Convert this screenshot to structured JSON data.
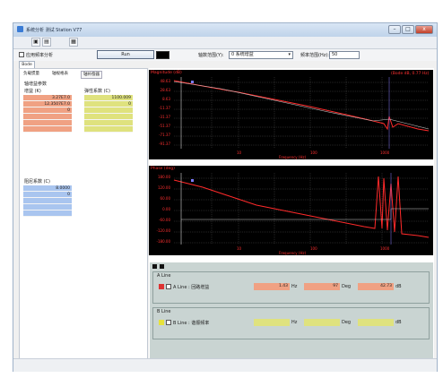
{
  "window": {
    "title": "系统分析 测试 Station V77",
    "controls": {
      "minimize": "–",
      "maximize": "□",
      "close": "x"
    }
  },
  "toolbar": {
    "icons": [
      "open-icon",
      "save-icon",
      "grid-icon"
    ]
  },
  "options": {
    "checkbox_label": "应用频率分析",
    "run_label": "Run",
    "mode_label": "轴数范围(Y):",
    "mode_value": "0  系统增益",
    "freq_label": "频率范围(Hz):",
    "freq_value": "50"
  },
  "main_tab": "Bode",
  "left": {
    "tabs": [
      "负载惯量",
      "轴规格表",
      "轴补偿器"
    ],
    "section_title": "轴增益参数",
    "col_left_header": "增益 (K)",
    "col_right_header": "弹性系数 (C)",
    "left_values": [
      "3.27E7.0",
      "12.3507E7.0",
      "0",
      "",
      "",
      ""
    ],
    "right_values": [
      "1100.009",
      "0",
      "",
      "",
      "",
      ""
    ],
    "lower_header": "阻尼系数 (C)",
    "lower_values": [
      "8.0000",
      "0",
      "",
      "",
      ""
    ]
  },
  "plots": {
    "magnitude": {
      "title": "Magnitude (dB)",
      "readout": "(Bode dB, 0.77 Hz)",
      "yticks": [
        "48.63",
        "28.63",
        "8.63",
        "-11.37",
        "-31.37",
        "-51.37",
        "-71.37",
        "-91.37"
      ],
      "xticks": [
        "10",
        "100",
        "1000"
      ],
      "xlabel": "Frequency (Hz)"
    },
    "phase": {
      "title": "Phase (deg)",
      "yticks": [
        "180.00",
        "120.00",
        "60.00",
        "0.00",
        "-60.00",
        "-120.00",
        "-180.00"
      ],
      "xticks": [
        "10",
        "100",
        "1000"
      ],
      "xlabel": "Frequency (Hz)"
    }
  },
  "cursors": {
    "group_a": {
      "title": "A Line",
      "row_label": "A Line : 回路增益",
      "freq": "1.43",
      "freq_unit": "Hz",
      "phase": "97",
      "phase_unit": "Deg",
      "mag": "42.73",
      "mag_unit": "dB"
    },
    "group_b": {
      "title": "B Line",
      "row_label": "B Line : 谐振频率",
      "freq": "",
      "freq_unit": "Hz",
      "phase": "",
      "phase_unit": "Deg",
      "mag": "",
      "mag_unit": "dB"
    }
  },
  "colors": {
    "trace": "#ff2a2a",
    "cursor_a": "#f0a183",
    "cursor_b": "#dfe27e",
    "cursor_c": "#a9c5ef"
  }
}
